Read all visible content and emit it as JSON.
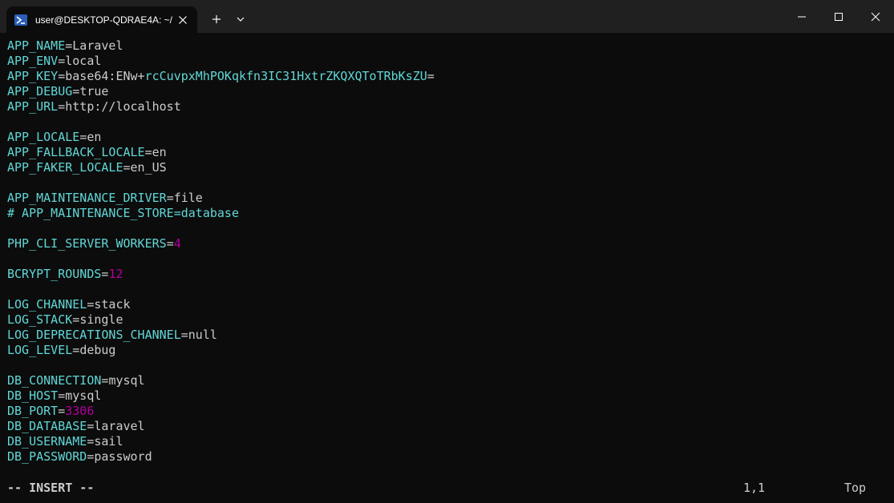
{
  "window": {
    "tab_title": "user@DESKTOP-QDRAE4A: ~/"
  },
  "colors": {
    "background": "#0c0c0c",
    "titlebar": "#202020",
    "key": "#61d6d6",
    "value": "#cccccc",
    "number": "#b4009e"
  },
  "icons": {
    "tab": "powershell-icon",
    "close": "close-icon",
    "new_tab": "plus-icon",
    "dropdown": "chevron-down-icon",
    "minimize": "minimize-icon",
    "maximize": "maximize-icon",
    "window_close": "close-icon"
  },
  "editor": {
    "lines": [
      {
        "key": "APP_NAME",
        "sep": "=",
        "value": "Laravel",
        "vtype": "val"
      },
      {
        "key": "APP_ENV",
        "sep": "=",
        "value": "local",
        "vtype": "val"
      },
      {
        "key": "APP_KEY",
        "sep": "=",
        "value": "base64:ENw+",
        "vtype": "val",
        "extra": "rcCuvpxMhPOKqkfn3IC31HxtrZKQXQToTRbKsZU",
        "extra2": "="
      },
      {
        "key": "APP_DEBUG",
        "sep": "=",
        "value": "true",
        "vtype": "val"
      },
      {
        "key": "APP_URL",
        "sep": "=",
        "value": "http://localhost",
        "vtype": "val"
      },
      {
        "blank": true
      },
      {
        "key": "APP_LOCALE",
        "sep": "=",
        "value": "en",
        "vtype": "val"
      },
      {
        "key": "APP_FALLBACK_LOCALE",
        "sep": "=",
        "value": "en",
        "vtype": "val"
      },
      {
        "key": "APP_FAKER_LOCALE",
        "sep": "=",
        "value": "en_US",
        "vtype": "val"
      },
      {
        "blank": true
      },
      {
        "key": "APP_MAINTENANCE_DRIVER",
        "sep": "=",
        "value": "file",
        "vtype": "val"
      },
      {
        "comment": "# APP_MAINTENANCE_STORE=database"
      },
      {
        "blank": true
      },
      {
        "key": "PHP_CLI_SERVER_WORKERS",
        "sep": "=",
        "value": "4",
        "vtype": "num"
      },
      {
        "blank": true
      },
      {
        "key": "BCRYPT_ROUNDS",
        "sep": "=",
        "value": "12",
        "vtype": "num"
      },
      {
        "blank": true
      },
      {
        "key": "LOG_CHANNEL",
        "sep": "=",
        "value": "stack",
        "vtype": "val"
      },
      {
        "key": "LOG_STACK",
        "sep": "=",
        "value": "single",
        "vtype": "val"
      },
      {
        "key": "LOG_DEPRECATIONS_CHANNEL",
        "sep": "=",
        "value": "null",
        "vtype": "val"
      },
      {
        "key": "LOG_LEVEL",
        "sep": "=",
        "value": "debug",
        "vtype": "val"
      },
      {
        "blank": true
      },
      {
        "key": "DB_CONNECTION",
        "sep": "=",
        "value": "mysql",
        "vtype": "val"
      },
      {
        "key": "DB_HOST",
        "sep": "=",
        "value": "mysql",
        "vtype": "val"
      },
      {
        "key": "DB_PORT",
        "sep": "=",
        "value": "3306",
        "vtype": "num"
      },
      {
        "key": "DB_DATABASE",
        "sep": "=",
        "value": "laravel",
        "vtype": "val"
      },
      {
        "key": "DB_USERNAME",
        "sep": "=",
        "value": "sail",
        "vtype": "val"
      },
      {
        "key": "DB_PASSWORD",
        "sep": "=",
        "value": "password",
        "vtype": "val"
      }
    ]
  },
  "status": {
    "mode": "-- INSERT --",
    "position": "1,1",
    "scroll": "Top"
  }
}
